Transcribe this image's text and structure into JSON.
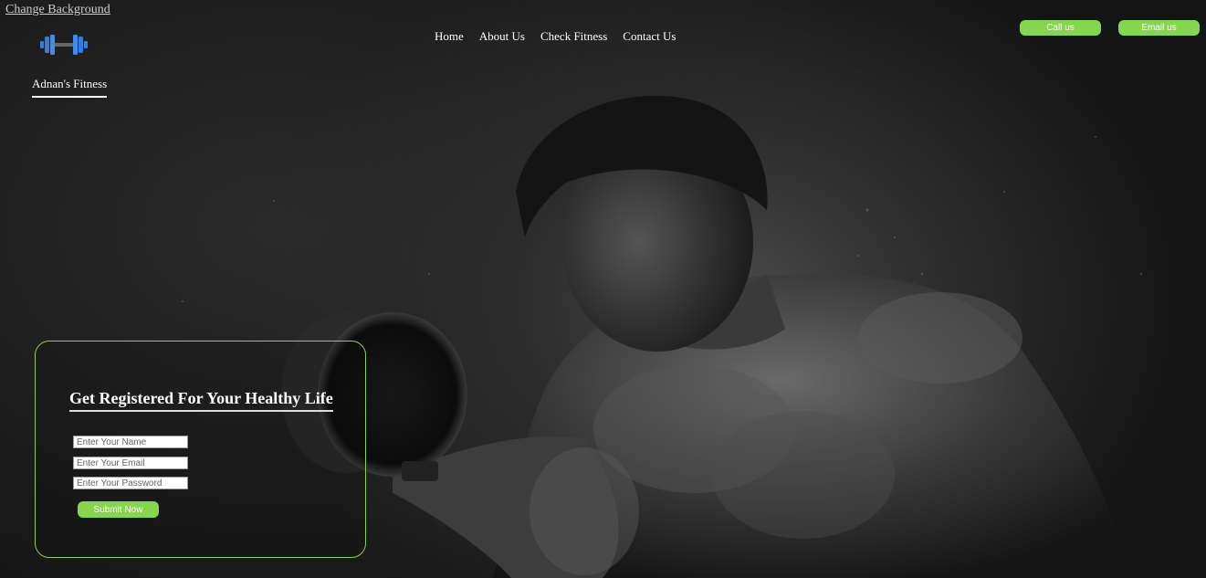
{
  "header": {
    "change_background_label": "Change Background",
    "brand_name": "Adnan's Fitness",
    "logo_icon": "dumbbell-icon"
  },
  "nav": {
    "items": [
      {
        "label": "Home"
      },
      {
        "label": "About Us"
      },
      {
        "label": "Check Fitness"
      },
      {
        "label": "Contact Us"
      }
    ]
  },
  "actions": {
    "call_label": "Call us",
    "email_label": "Email us"
  },
  "registration": {
    "title": "Get Registered For Your Healthy Life",
    "name_placeholder": "Enter Your Name",
    "email_placeholder": "Enter Your Email",
    "password_placeholder": "Enter Your Password",
    "submit_label": "Submit Now"
  },
  "colors": {
    "accent": "#84d64c",
    "logo_blue": "#2f7fe0",
    "background": "#1a1a1a"
  }
}
